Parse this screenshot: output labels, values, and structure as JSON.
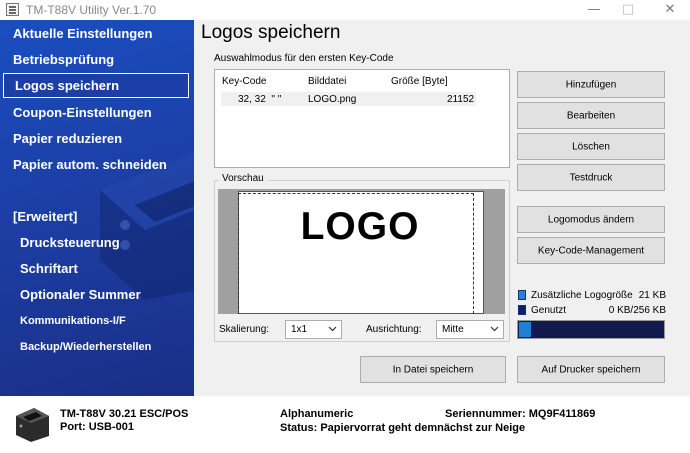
{
  "window": {
    "title": "TM-T88V Utility Ver.1.70",
    "controls": [
      "minimize",
      "maximize",
      "close"
    ]
  },
  "sidebar": {
    "items": [
      {
        "label": "Aktuelle Einstellungen"
      },
      {
        "label": "Betriebsprüfung"
      },
      {
        "label": "Logos speichern",
        "active": true
      },
      {
        "label": "Coupon-Einstellungen"
      },
      {
        "label": "Papier reduzieren"
      },
      {
        "label": "Papier autom. schneiden"
      }
    ],
    "advanced_header": "[Erweitert]",
    "advanced_items": [
      {
        "label": "Drucksteuerung"
      },
      {
        "label": "Schriftart"
      },
      {
        "label": "Optionaler Summer"
      },
      {
        "label": "Kommunikations-I/F"
      },
      {
        "label": "Backup/Wiederherstellen"
      }
    ]
  },
  "main": {
    "title": "Logos speichern",
    "mode_label": "Auswahlmodus für den ersten Key-Code",
    "table": {
      "headers": [
        "Key-Code",
        "Bilddatei",
        "Größe [Byte]"
      ],
      "rows": [
        {
          "key_code": "32, 32  \" \"",
          "file": "LOGO.png",
          "size": "21152"
        }
      ]
    },
    "preview": {
      "label": "Vorschau",
      "logo_text": "LOGO"
    },
    "scaling": {
      "label": "Skalierung:",
      "value": "1x1"
    },
    "alignment": {
      "label": "Ausrichtung:",
      "value": "Mitte"
    },
    "buttons": {
      "add": "Hinzufügen",
      "edit": "Bearbeiten",
      "delete": "Löschen",
      "test_print": "Testdruck",
      "change_logo_mode": "Logomodus ändern",
      "key_code_management": "Key-Code-Management",
      "save_to_file": "In Datei speichern",
      "save_to_printer": "Auf Drucker speichern"
    },
    "memory": {
      "additional_label": "Zusätzliche Logogröße",
      "additional_value": "21 KB",
      "used_label": "Genutzt",
      "used_value": "0 KB/256 KB",
      "used_fraction": 0.08,
      "colors": {
        "track": "#121a4d",
        "fill": "#1f7fd6"
      }
    }
  },
  "status": {
    "model": "TM-T88V 30.21 ESC/POS",
    "port": "Port: USB-001",
    "charset": "Alphanumeric",
    "serial": "Seriennummer: MQ9F411869",
    "status_text": "Status: Papiervorrat geht demnächst zur Neige"
  },
  "colors": {
    "sidebar_top": "#1a4ec0",
    "sidebar_bottom": "#1a2f86",
    "button_bg": "#e1e1e1"
  }
}
